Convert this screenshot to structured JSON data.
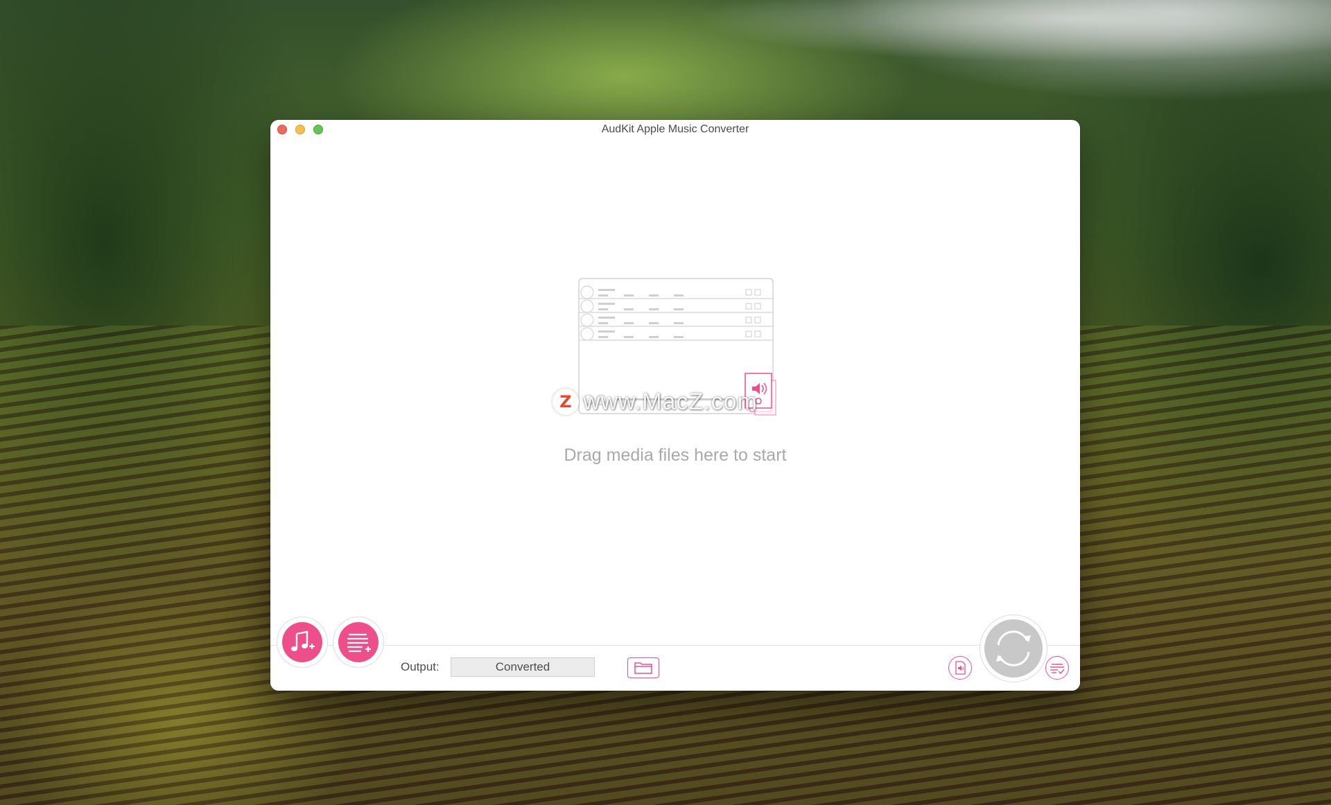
{
  "window": {
    "title": "AudKit Apple Music Converter"
  },
  "drop_area": {
    "hint": "Drag media files here to start"
  },
  "bottom_bar": {
    "output_label": "Output:",
    "output_value": "Converted"
  },
  "watermark": {
    "text": "www.MacZ.com",
    "logo_letter": "Z"
  },
  "colors": {
    "accent": "#ee4f8b",
    "convert_disabled": "#c8c8c8",
    "close": "#ed6a5e",
    "minimize": "#f5bf4f",
    "maximize": "#62c554"
  },
  "icons": {
    "add_music": "music-note-plus-icon",
    "add_playlist": "list-plus-icon",
    "folder": "folder-icon",
    "audio_effect": "audio-file-icon",
    "convert": "refresh-arrows-icon",
    "history": "converted-list-icon"
  }
}
